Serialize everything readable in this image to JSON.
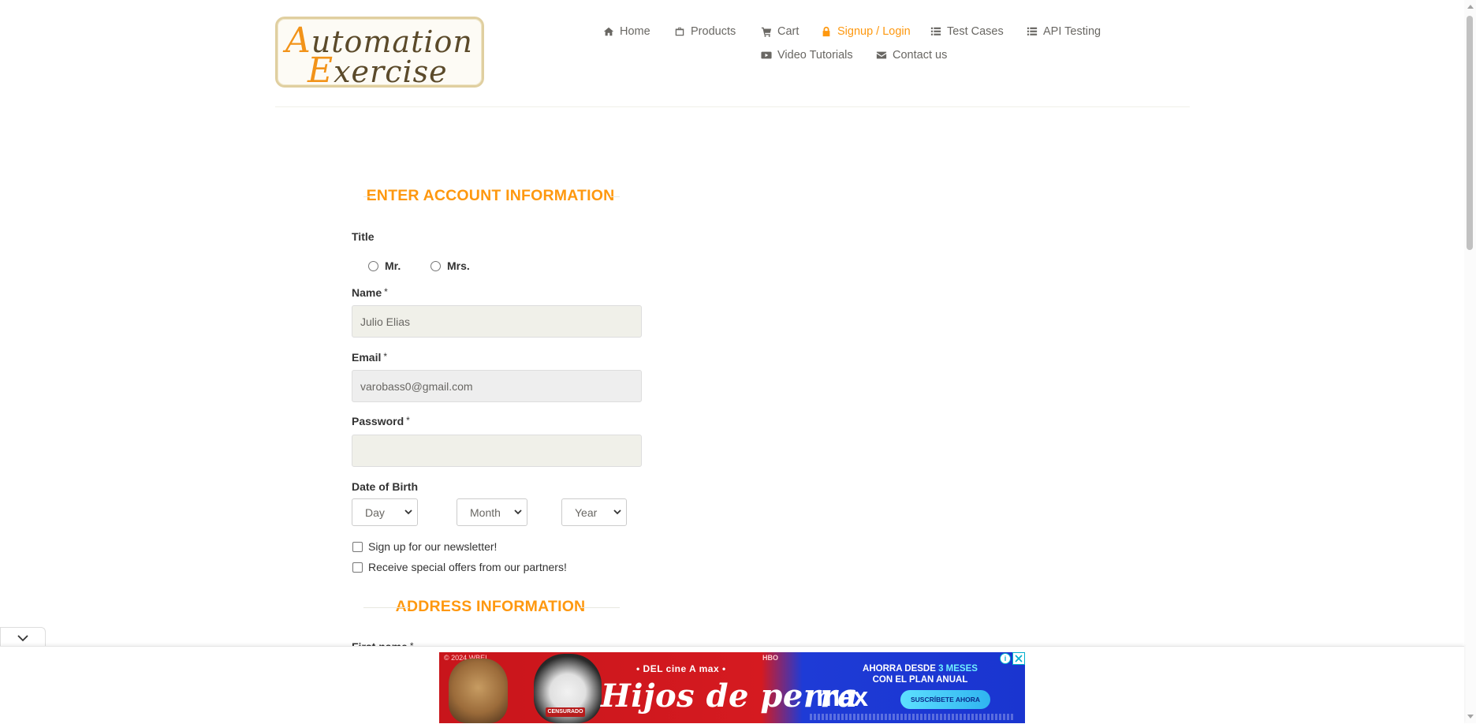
{
  "logo": {
    "line1_cap": "A",
    "line1_rest": "utomation",
    "line2_cap": "E",
    "line2_rest": "xercise"
  },
  "nav": {
    "home": "Home",
    "products": "Products",
    "cart": "Cart",
    "signup_login": "Signup / Login",
    "test_cases": "Test Cases",
    "api_testing": "API Testing",
    "video_tutorials": "Video Tutorials",
    "contact_us": "Contact us",
    "active_color": "#fe980f"
  },
  "form": {
    "section_title": "ENTER ACCOUNT INFORMATION",
    "title_label": "Title",
    "title_options": [
      "Mr.",
      "Mrs."
    ],
    "name_label": "Name",
    "name_value": "Julio Elias",
    "email_label": "Email",
    "email_value": "varobass0@gmail.com",
    "password_label": "Password",
    "password_value": "",
    "required_marker": "*",
    "dob_label": "Date of Birth",
    "day_select": "Day",
    "month_select": "Month",
    "year_select": "Year",
    "newsletter_label": "Sign up for our newsletter!",
    "offers_label": "Receive special offers from our partners!",
    "address_title": "ADDRESS INFORMATION",
    "first_name_label": "First name"
  },
  "ad": {
    "copyright": "© 2024 WBEI",
    "network": "HBO",
    "tagline": "• DEL cine A max •",
    "title": "Hijos de perra",
    "badge": "CENSURADO",
    "promo_line1": "AHORRA DESDE",
    "promo_highlight": "3 MESES",
    "promo_line2": "CON EL PLAN ANUAL",
    "brand": "max",
    "cta": "SUSCRÍBETE AHORA"
  },
  "colors": {
    "accent": "#fe980f",
    "input_bg": "#f0f0e9",
    "text": "#696763"
  }
}
